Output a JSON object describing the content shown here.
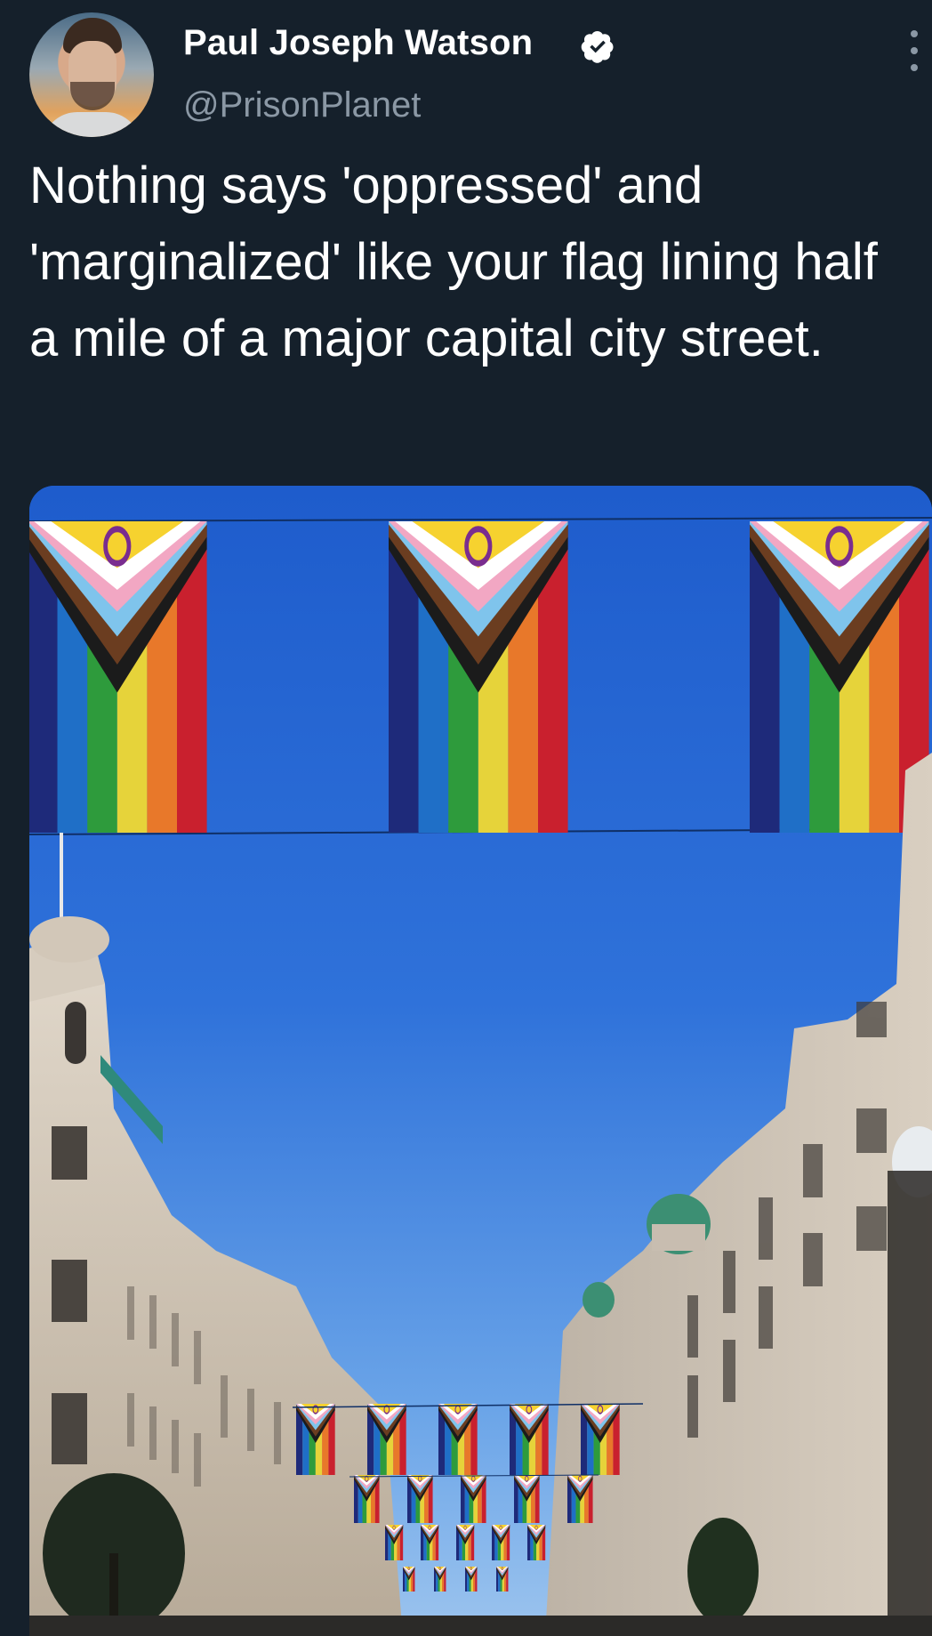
{
  "tweet": {
    "author": {
      "name": "Paul Joseph Watson",
      "handle": "@PrisonPlanet",
      "verified": true,
      "avatar_icon": "user-avatar"
    },
    "text": "Nothing says 'oppressed' and 'marginalized' like your flag lining half a mile of a major capital city street.",
    "more_icon": "more-vertical-icon",
    "media": {
      "type": "photo",
      "icon": "photo-of-street-with-pride-flags"
    }
  },
  "colors": {
    "background": "#15202b",
    "secondary_text": "#8b98a5",
    "sky": "#2f71d8",
    "intersex_yellow": "#f6d22f",
    "intersex_purple": "#7a2d8f"
  }
}
